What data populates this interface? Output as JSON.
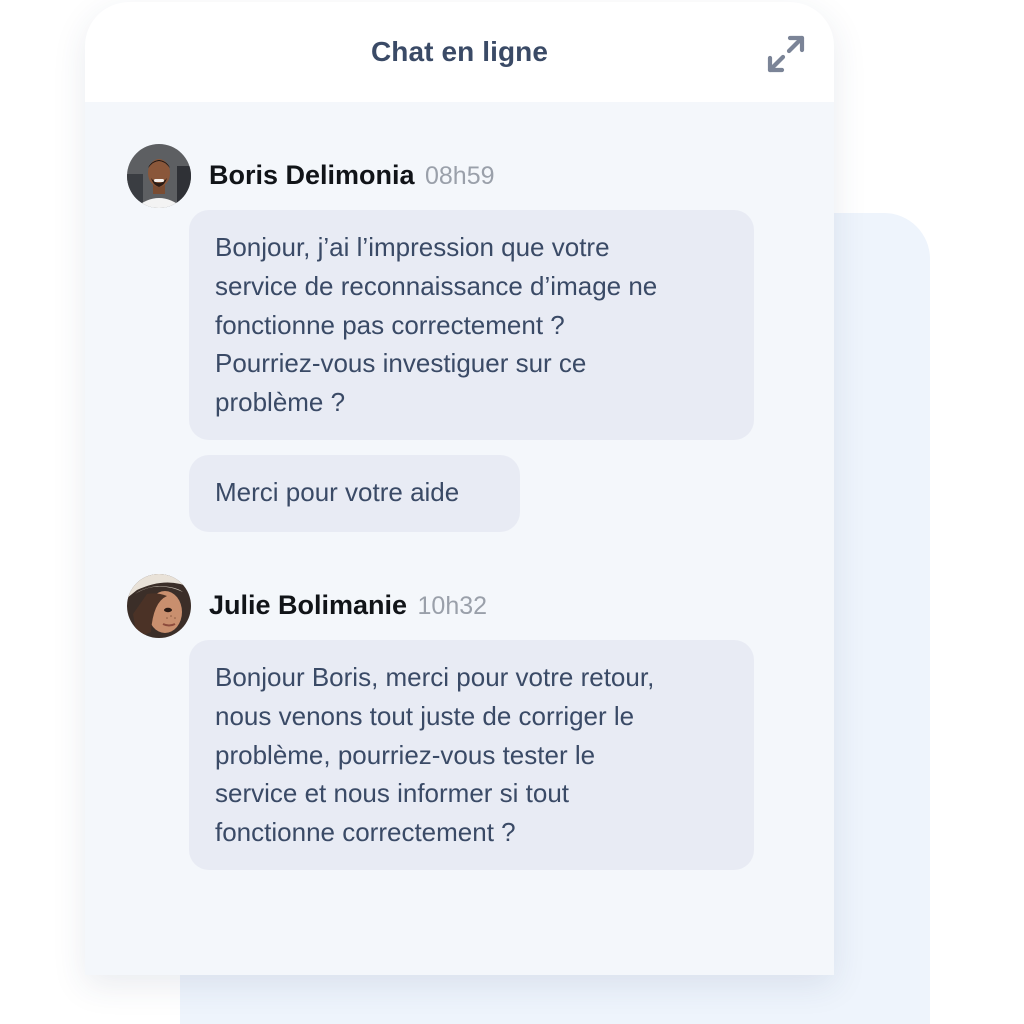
{
  "header": {
    "title": "Chat en ligne",
    "expand_icon": "expand-arrows-icon"
  },
  "colors": {
    "title": "#3a4a66",
    "bubble_bg": "#e8ebf4",
    "bubble_text": "#3a4a66",
    "chat_bg": "#f4f7fb",
    "time": "#9aa0aa"
  },
  "messages": [
    {
      "author": "Boris Delimonia",
      "time": "08h59",
      "bubbles": [
        "Bonjour, j’ai l’impression que votre\nservice de reconnaissance d’image ne\nfonctionne pas correctement ?\nPourriez-vous investiguer sur ce\nproblème ?",
        "Merci pour votre aide"
      ]
    },
    {
      "author": "Julie Bolimanie",
      "time": "10h32",
      "bubbles": [
        "Bonjour Boris, merci pour votre retour,\nnous venons tout juste de corriger le\nproblème, pourriez-vous tester le\nservice et nous informer si tout\nfonctionne correctement ?"
      ]
    }
  ]
}
